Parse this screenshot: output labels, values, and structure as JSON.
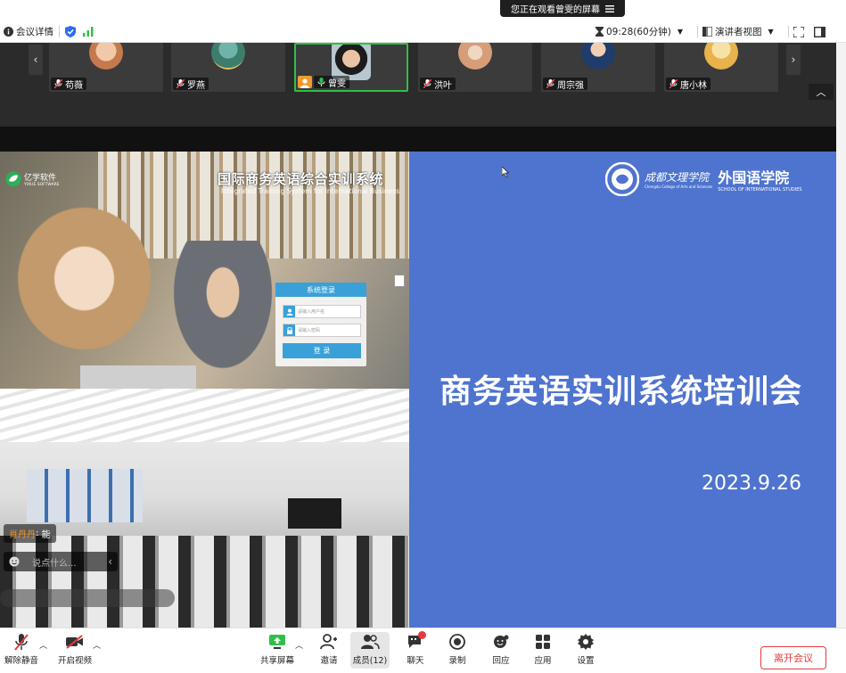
{
  "banner": {
    "text": "您正在观看曾雯的屏幕",
    "menu_icon": "menu-icon"
  },
  "toolbar": {
    "meeting_info": "会议详情",
    "timer": "09:28(60分钟)",
    "view_mode": "演讲者视图"
  },
  "participants": [
    {
      "name": "苟薇"
    },
    {
      "name": "罗燕"
    },
    {
      "name": "曾雯"
    },
    {
      "name": "洪叶"
    },
    {
      "name": "周宗强"
    },
    {
      "name": "唐小林"
    }
  ],
  "slide": {
    "system_title_cn": "国际商务英语综合实训系统",
    "system_title_en": "Integrated Training System for International Business",
    "software_logo": "亿学软件",
    "software_logo_en": "YIXUE SOFTWARE",
    "login_title": "系统登录",
    "login_user_placeholder": "请输入用户名",
    "login_pass_placeholder": "请输入密码",
    "login_button": "登 录",
    "school_name_cursive": "成都文理学院",
    "school_name_cursive_en": "Chengdu College of Arts and Sciences",
    "dept_name": "外国语学院",
    "dept_name_en": "SCHOOL OF INTERNATIONAL STUDIES",
    "main_title": "商务英语实训系统培训会",
    "date": "2023.9.26",
    "chat_sender": "肖丹丹",
    "chat_text": "能",
    "chat_placeholder": "说点什么..."
  },
  "bottom": {
    "unmute": "解除静音",
    "start_video": "开启视频",
    "share_screen": "共享屏幕",
    "invite": "邀请",
    "members": "成员(12)",
    "chat": "聊天",
    "record": "录制",
    "reactions": "回应",
    "apps": "应用",
    "settings": "设置",
    "leave": "离开会议"
  },
  "colors": {
    "slide_blue": "#4f74cf",
    "accent_green": "#2fbf4a",
    "leave_red": "#e23b3b",
    "dark": "#2b2b2b"
  }
}
